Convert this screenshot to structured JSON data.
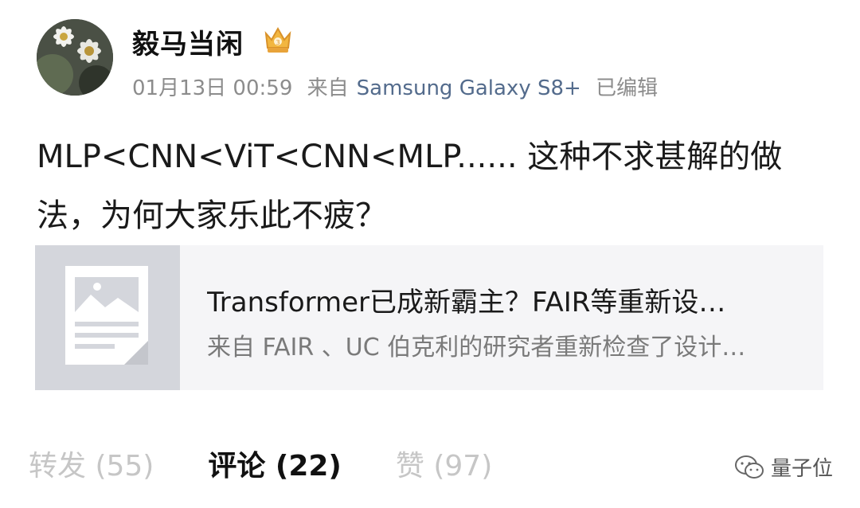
{
  "header": {
    "username": "毅马当闲",
    "date": "01月13日 00:59",
    "source_prefix": "来自",
    "device": "Samsung Galaxy S8+",
    "edited": "已编辑"
  },
  "post": {
    "text": " MLP<CNN<ViT<CNN<MLP...... 这种不求甚解的做法，为何大家乐此不疲？"
  },
  "link_card": {
    "title": "Transformer已成新霸主？FAIR等重新设…",
    "description": "来自 FAIR 、UC 伯克利的研究者重新检查了设计…"
  },
  "actions": {
    "repost": "转发 (55)",
    "comment": "评论 (22)",
    "like": "赞 (97)"
  },
  "watermark": {
    "text": "量子位"
  },
  "colors": {
    "link_blue": "#536b8c",
    "muted_gray": "#8c8c8c",
    "card_bg": "#f5f5f7"
  },
  "icons": {
    "vip": "vip-crown-icon",
    "thumb": "article-placeholder-icon",
    "watermark": "wechat-icon"
  }
}
